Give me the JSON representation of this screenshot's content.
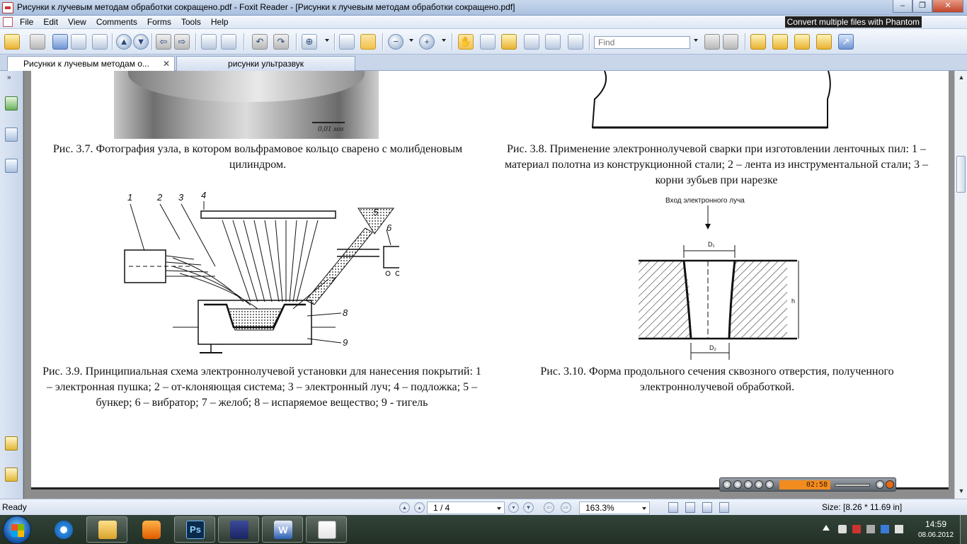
{
  "window": {
    "title": "Рисунки к лучевым методам обработки сокращено.pdf - Foxit Reader - [Рисунки к лучевым методам обработки сокращено.pdf]",
    "minimize": "‒",
    "maximize": "❐",
    "close": "✕"
  },
  "menu": {
    "items": [
      "File",
      "Edit",
      "View",
      "Comments",
      "Forms",
      "Tools",
      "Help"
    ],
    "promo": "Convert multiple files with Phantom"
  },
  "toolbar": {
    "find_placeholder": "Find"
  },
  "tabs": [
    {
      "label": "Рисунки к лучевым методам о...",
      "close": "✕"
    },
    {
      "label": "рисунки ультразвук"
    }
  ],
  "page": {
    "captions": {
      "fig37": "Рис. 3.7. Фотография узла, в котором вольфрамовое кольцо сварено с молибденовым цилиндром.",
      "fig38": "Рис. 3.8. Применение электроннолучевой сварки при изготовлении ленточных пил: 1 – материал полотна из конструкционной стали; 2 – лента из инструментальной стали; 3 – корни зубьев при нарезке",
      "fig39": "Рис. 3.9. Принципиальная схема электроннолучевой установки для нанесения покрытий: 1 – электронная пушка; 2 – от-клоняющая система; 3 – электронный луч; 4 – подложка; 5 – бункер; 6 – вибратор; 7 – желоб; 8 – испаряемое вещество; 9 - тигель",
      "fig310": "Рис. 3.10. Форма продольного сечения сквозного отверстия, полученного электроннолучевой обработкой."
    },
    "photo_scale": "0,01 мм",
    "fig39_labels": [
      "1",
      "2",
      "3",
      "4",
      "5",
      "6",
      "7",
      "8",
      "9"
    ],
    "fig310_labels": {
      "entry": "Вход электронного луча",
      "d1": "D₁",
      "d2": "D₂",
      "h": "h"
    }
  },
  "statusbar": {
    "ready": "Ready",
    "page_indicator": "1 / 4",
    "zoom": "163.3%",
    "size": "Size: [8.26 * 11.69 in]"
  },
  "player": {
    "time": "02:58"
  },
  "taskbar": {
    "clock_time": "14:59",
    "clock_date": "08.06.2012",
    "ps_label": "Ps",
    "word_label": "W"
  },
  "colors": {
    "accent": "#a9c0df",
    "page_bg": "#ffffff",
    "doc_bg": "#8d8d8d"
  }
}
